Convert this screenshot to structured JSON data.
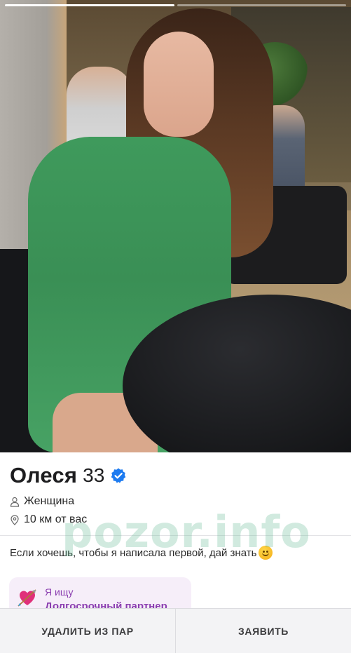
{
  "stories": {
    "total": 2,
    "active_index": 0
  },
  "photo": {
    "description_icon": "profile-photo"
  },
  "profile": {
    "name": "Олеся",
    "age": "33",
    "verified": true,
    "gender": "Женщина",
    "distance": "10 км от вас",
    "bio": "Если хочешь, чтобы я написала первой, дай знать",
    "bio_emoji": "smiling-face-emoji",
    "looking_for": {
      "label": "Я ищу",
      "value": "Долгосрочный партнер",
      "icon": "heart-arrow-icon"
    }
  },
  "watermark": "pozor.info",
  "actions": {
    "unmatch_label": "УДАЛИТЬ ИЗ ПАР",
    "report_label": "ЗАЯВИТЬ"
  },
  "colors": {
    "verified_badge": "#1d7bf0",
    "looking_bg": "#f6eef9",
    "looking_text": "#8b3fb0",
    "action_bar_bg": "#f3f3f5"
  }
}
